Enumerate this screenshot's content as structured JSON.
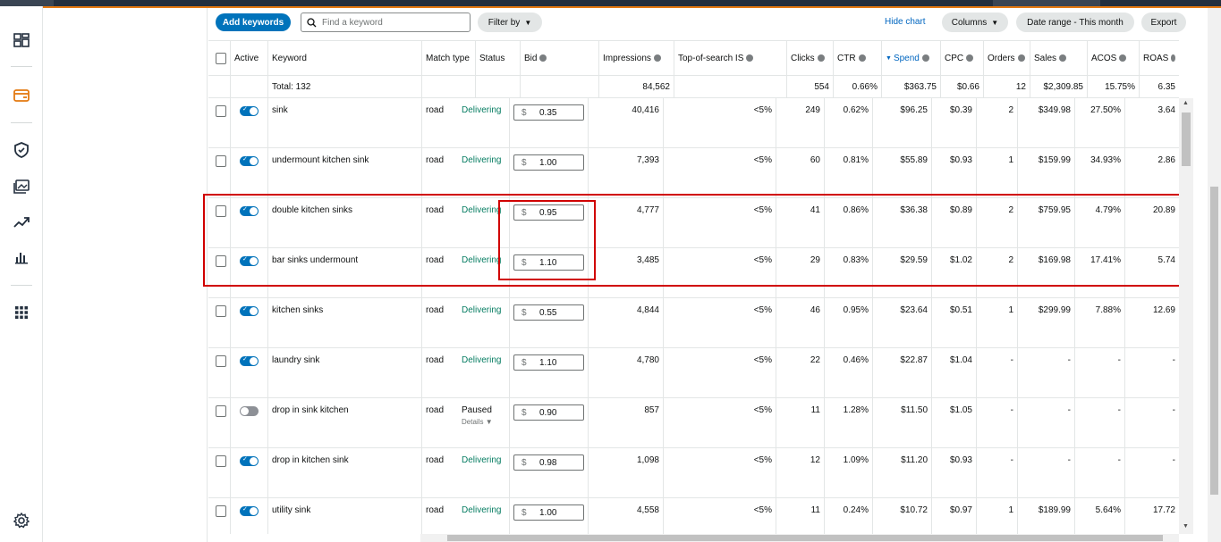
{
  "toolbar": {
    "add_keywords": "Add keywords",
    "search_placeholder": "Find a keyword",
    "filter_by": "Filter by",
    "hide_chart": "Hide chart",
    "columns": "Columns",
    "date_range": "Date range - This month",
    "export": "Export"
  },
  "columns": {
    "active": "Active",
    "keyword": "Keyword",
    "match_type": "Match type",
    "status": "Status",
    "bid": "Bid",
    "impressions": "Impressions",
    "top_of_search": "Top-of-search IS",
    "clicks": "Clicks",
    "ctr": "CTR",
    "spend": "Spend",
    "cpc": "CPC",
    "orders": "Orders",
    "sales": "Sales",
    "acos": "ACOS",
    "roas": "ROAS"
  },
  "totals": {
    "label": "Total: 132",
    "impressions": "84,562",
    "clicks": "554",
    "ctr": "0.66%",
    "spend": "$363.75",
    "cpc": "$0.66",
    "orders": "12",
    "sales": "$2,309.85",
    "acos": "15.75%",
    "roas": "6.35"
  },
  "currency": "$",
  "rows": [
    {
      "keyword": "sink",
      "match": "road",
      "status": "Delivering",
      "bid": "0.35",
      "impressions": "40,416",
      "tos": "<5%",
      "clicks": "249",
      "ctr": "0.62%",
      "spend": "$96.25",
      "cpc": "$0.39",
      "orders": "2",
      "sales": "$349.98",
      "acos": "27.50%",
      "roas": "3.64",
      "active": true
    },
    {
      "keyword": "undermount kitchen sink",
      "match": "road",
      "status": "Delivering",
      "bid": "1.00",
      "impressions": "7,393",
      "tos": "<5%",
      "clicks": "60",
      "ctr": "0.81%",
      "spend": "$55.89",
      "cpc": "$0.93",
      "orders": "1",
      "sales": "$159.99",
      "acos": "34.93%",
      "roas": "2.86",
      "active": true
    },
    {
      "keyword": "double kitchen sinks",
      "match": "road",
      "status": "Delivering",
      "bid": "0.95",
      "impressions": "4,777",
      "tos": "<5%",
      "clicks": "41",
      "ctr": "0.86%",
      "spend": "$36.38",
      "cpc": "$0.89",
      "orders": "2",
      "sales": "$759.95",
      "acos": "4.79%",
      "roas": "20.89",
      "active": true
    },
    {
      "keyword": "bar sinks undermount",
      "match": "road",
      "status": "Delivering",
      "bid": "1.10",
      "impressions": "3,485",
      "tos": "<5%",
      "clicks": "29",
      "ctr": "0.83%",
      "spend": "$29.59",
      "cpc": "$1.02",
      "orders": "2",
      "sales": "$169.98",
      "acos": "17.41%",
      "roas": "5.74",
      "active": true
    },
    {
      "keyword": "kitchen sinks",
      "match": "road",
      "status": "Delivering",
      "bid": "0.55",
      "impressions": "4,844",
      "tos": "<5%",
      "clicks": "46",
      "ctr": "0.95%",
      "spend": "$23.64",
      "cpc": "$0.51",
      "orders": "1",
      "sales": "$299.99",
      "acos": "7.88%",
      "roas": "12.69",
      "active": true
    },
    {
      "keyword": "laundry sink",
      "match": "road",
      "status": "Delivering",
      "bid": "1.10",
      "impressions": "4,780",
      "tos": "<5%",
      "clicks": "22",
      "ctr": "0.46%",
      "spend": "$22.87",
      "cpc": "$1.04",
      "orders": "-",
      "sales": "-",
      "acos": "-",
      "roas": "-",
      "active": true
    },
    {
      "keyword": "drop in sink kitchen",
      "match": "road",
      "status": "Paused",
      "status_detail": "Details",
      "bid": "0.90",
      "impressions": "857",
      "tos": "<5%",
      "clicks": "11",
      "ctr": "1.28%",
      "spend": "$11.50",
      "cpc": "$1.05",
      "orders": "-",
      "sales": "-",
      "acos": "-",
      "roas": "-",
      "active": false
    },
    {
      "keyword": "drop in kitchen sink",
      "match": "road",
      "status": "Delivering",
      "bid": "0.98",
      "impressions": "1,098",
      "tos": "<5%",
      "clicks": "12",
      "ctr": "1.09%",
      "spend": "$11.20",
      "cpc": "$0.93",
      "orders": "-",
      "sales": "-",
      "acos": "-",
      "roas": "-",
      "active": true
    },
    {
      "keyword": "utility sink",
      "match": "road",
      "status": "Delivering",
      "bid": "1.00",
      "impressions": "4,558",
      "tos": "<5%",
      "clicks": "11",
      "ctr": "0.24%",
      "spend": "$10.72",
      "cpc": "$0.97",
      "orders": "1",
      "sales": "$189.99",
      "acos": "5.64%",
      "roas": "17.72",
      "active": true
    }
  ],
  "colors": {
    "accent": "#0073bb",
    "delivering": "#067d62",
    "highlight": "#d00000",
    "topbar": "#232f3e",
    "orange": "#e47911"
  }
}
